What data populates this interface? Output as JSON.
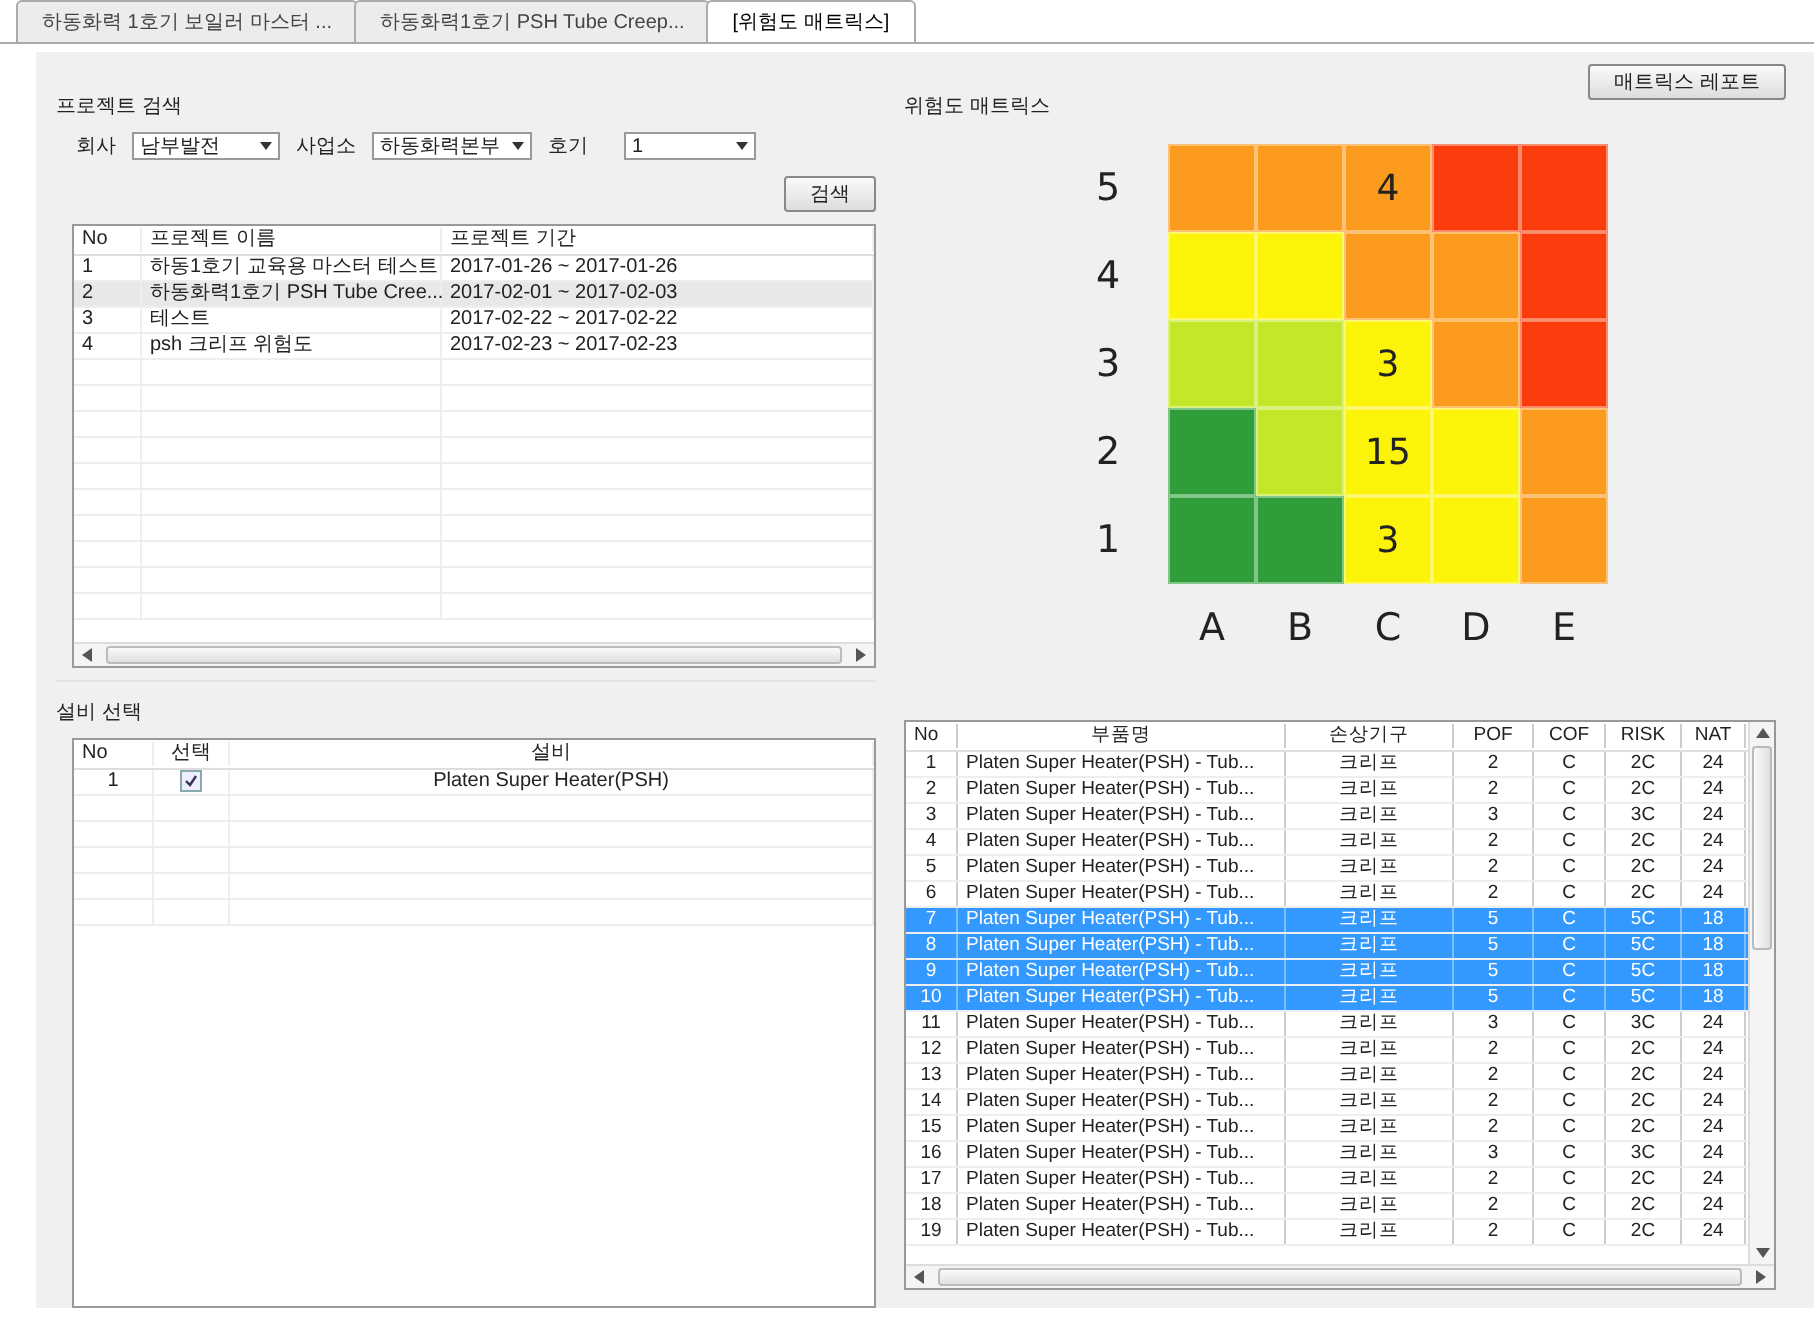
{
  "tabs": [
    {
      "label": "하동화력 1호기 보일러 마스터 ...",
      "selected": false
    },
    {
      "label": "하동화력1호기 PSH Tube Creep...",
      "selected": false
    },
    {
      "label": "[위험도 매트릭스]",
      "selected": true
    }
  ],
  "project_search": {
    "title": "프로젝트 검색",
    "filters": [
      {
        "label": "회사",
        "value": "남부발전"
      },
      {
        "label": "사업소",
        "value": "하동화력본부"
      },
      {
        "label": "호기",
        "value": "1"
      }
    ],
    "search_button": "검색",
    "table": {
      "columns": [
        "No",
        "프로젝트 이름",
        "프로젝트 기간"
      ],
      "rows": [
        {
          "cells": [
            "1",
            "하동1호기 교육용 마스터 테스트",
            "2017-01-26 ~ 2017-01-26"
          ],
          "selected": false
        },
        {
          "cells": [
            "2",
            "하동화력1호기 PSH Tube Cree...",
            "2017-02-01 ~ 2017-02-03"
          ],
          "selected": true
        },
        {
          "cells": [
            "3",
            "테스트",
            "2017-02-22 ~ 2017-02-22"
          ],
          "selected": false
        },
        {
          "cells": [
            "4",
            "psh 크리프 위험도",
            "2017-02-23 ~ 2017-02-23"
          ],
          "selected": false
        }
      ]
    }
  },
  "equipment": {
    "title": "설비 선택",
    "columns": [
      "No",
      "선택",
      "설비"
    ],
    "rows": [
      {
        "no": "1",
        "checked": true,
        "name": "Platen Super Heater(PSH)"
      }
    ]
  },
  "matrix": {
    "title": "위험도 매트릭스",
    "report_button": "매트릭스 레포트",
    "rows": [
      {
        "label": "5",
        "cells": [
          {
            "color": "#fb9a1c"
          },
          {
            "color": "#fb9a1c"
          },
          {
            "color": "#fb9a1c",
            "value": "4"
          },
          {
            "color": "#fb3c0c"
          },
          {
            "color": "#fb3c0c"
          }
        ]
      },
      {
        "label": "4",
        "cells": [
          {
            "color": "#fbf30a"
          },
          {
            "color": "#fbf30a"
          },
          {
            "color": "#fb9a1c"
          },
          {
            "color": "#fb9a1c"
          },
          {
            "color": "#fb3c0c"
          }
        ]
      },
      {
        "label": "3",
        "cells": [
          {
            "color": "#c3e82a"
          },
          {
            "color": "#c3e82a"
          },
          {
            "color": "#fbf30a",
            "value": "3"
          },
          {
            "color": "#fb9a1c"
          },
          {
            "color": "#fb3c0c"
          }
        ]
      },
      {
        "label": "2",
        "cells": [
          {
            "color": "#2f9e3a"
          },
          {
            "color": "#c3e82a"
          },
          {
            "color": "#fbf30a",
            "value": "15"
          },
          {
            "color": "#fbf30a"
          },
          {
            "color": "#fb9a1c"
          }
        ]
      },
      {
        "label": "1",
        "cells": [
          {
            "color": "#2f9e3a"
          },
          {
            "color": "#2f9e3a"
          },
          {
            "color": "#fbf30a",
            "value": "3"
          },
          {
            "color": "#fbf30a"
          },
          {
            "color": "#fb9a1c"
          }
        ]
      }
    ],
    "column_labels": [
      "A",
      "B",
      "C",
      "D",
      "E"
    ]
  },
  "parts_table": {
    "columns": [
      "No",
      "부품명",
      "손상기구",
      "POF",
      "COF",
      "RISK",
      "NAT"
    ],
    "rows": [
      {
        "cells": [
          "1",
          "Platen Super Heater(PSH) - Tub...",
          "크리프",
          "2",
          "C",
          "2C",
          "24"
        ],
        "selected": false
      },
      {
        "cells": [
          "2",
          "Platen Super Heater(PSH) - Tub...",
          "크리프",
          "2",
          "C",
          "2C",
          "24"
        ],
        "selected": false
      },
      {
        "cells": [
          "3",
          "Platen Super Heater(PSH) - Tub...",
          "크리프",
          "3",
          "C",
          "3C",
          "24"
        ],
        "selected": false
      },
      {
        "cells": [
          "4",
          "Platen Super Heater(PSH) - Tub...",
          "크리프",
          "2",
          "C",
          "2C",
          "24"
        ],
        "selected": false
      },
      {
        "cells": [
          "5",
          "Platen Super Heater(PSH) - Tub...",
          "크리프",
          "2",
          "C",
          "2C",
          "24"
        ],
        "selected": false
      },
      {
        "cells": [
          "6",
          "Platen Super Heater(PSH) - Tub...",
          "크리프",
          "2",
          "C",
          "2C",
          "24"
        ],
        "selected": false
      },
      {
        "cells": [
          "7",
          "Platen Super Heater(PSH) - Tub...",
          "크리프",
          "5",
          "C",
          "5C",
          "18"
        ],
        "selected": true
      },
      {
        "cells": [
          "8",
          "Platen Super Heater(PSH) - Tub...",
          "크리프",
          "5",
          "C",
          "5C",
          "18"
        ],
        "selected": true
      },
      {
        "cells": [
          "9",
          "Platen Super Heater(PSH) - Tub...",
          "크리프",
          "5",
          "C",
          "5C",
          "18"
        ],
        "selected": true
      },
      {
        "cells": [
          "10",
          "Platen Super Heater(PSH) - Tub...",
          "크리프",
          "5",
          "C",
          "5C",
          "18"
        ],
        "selected": true
      },
      {
        "cells": [
          "11",
          "Platen Super Heater(PSH) - Tub...",
          "크리프",
          "3",
          "C",
          "3C",
          "24"
        ],
        "selected": false
      },
      {
        "cells": [
          "12",
          "Platen Super Heater(PSH) - Tub...",
          "크리프",
          "2",
          "C",
          "2C",
          "24"
        ],
        "selected": false
      },
      {
        "cells": [
          "13",
          "Platen Super Heater(PSH) - Tub...",
          "크리프",
          "2",
          "C",
          "2C",
          "24"
        ],
        "selected": false
      },
      {
        "cells": [
          "14",
          "Platen Super Heater(PSH) - Tub...",
          "크리프",
          "2",
          "C",
          "2C",
          "24"
        ],
        "selected": false
      },
      {
        "cells": [
          "15",
          "Platen Super Heater(PSH) - Tub...",
          "크리프",
          "2",
          "C",
          "2C",
          "24"
        ],
        "selected": false
      },
      {
        "cells": [
          "16",
          "Platen Super Heater(PSH) - Tub...",
          "크리프",
          "3",
          "C",
          "3C",
          "24"
        ],
        "selected": false
      },
      {
        "cells": [
          "17",
          "Platen Super Heater(PSH) - Tub...",
          "크리프",
          "2",
          "C",
          "2C",
          "24"
        ],
        "selected": false
      },
      {
        "cells": [
          "18",
          "Platen Super Heater(PSH) - Tub...",
          "크리프",
          "2",
          "C",
          "2C",
          "24"
        ],
        "selected": false
      },
      {
        "cells": [
          "19",
          "Platen Super Heater(PSH) - Tub...",
          "크리프",
          "2",
          "C",
          "2C",
          "24"
        ],
        "selected": false
      }
    ]
  }
}
